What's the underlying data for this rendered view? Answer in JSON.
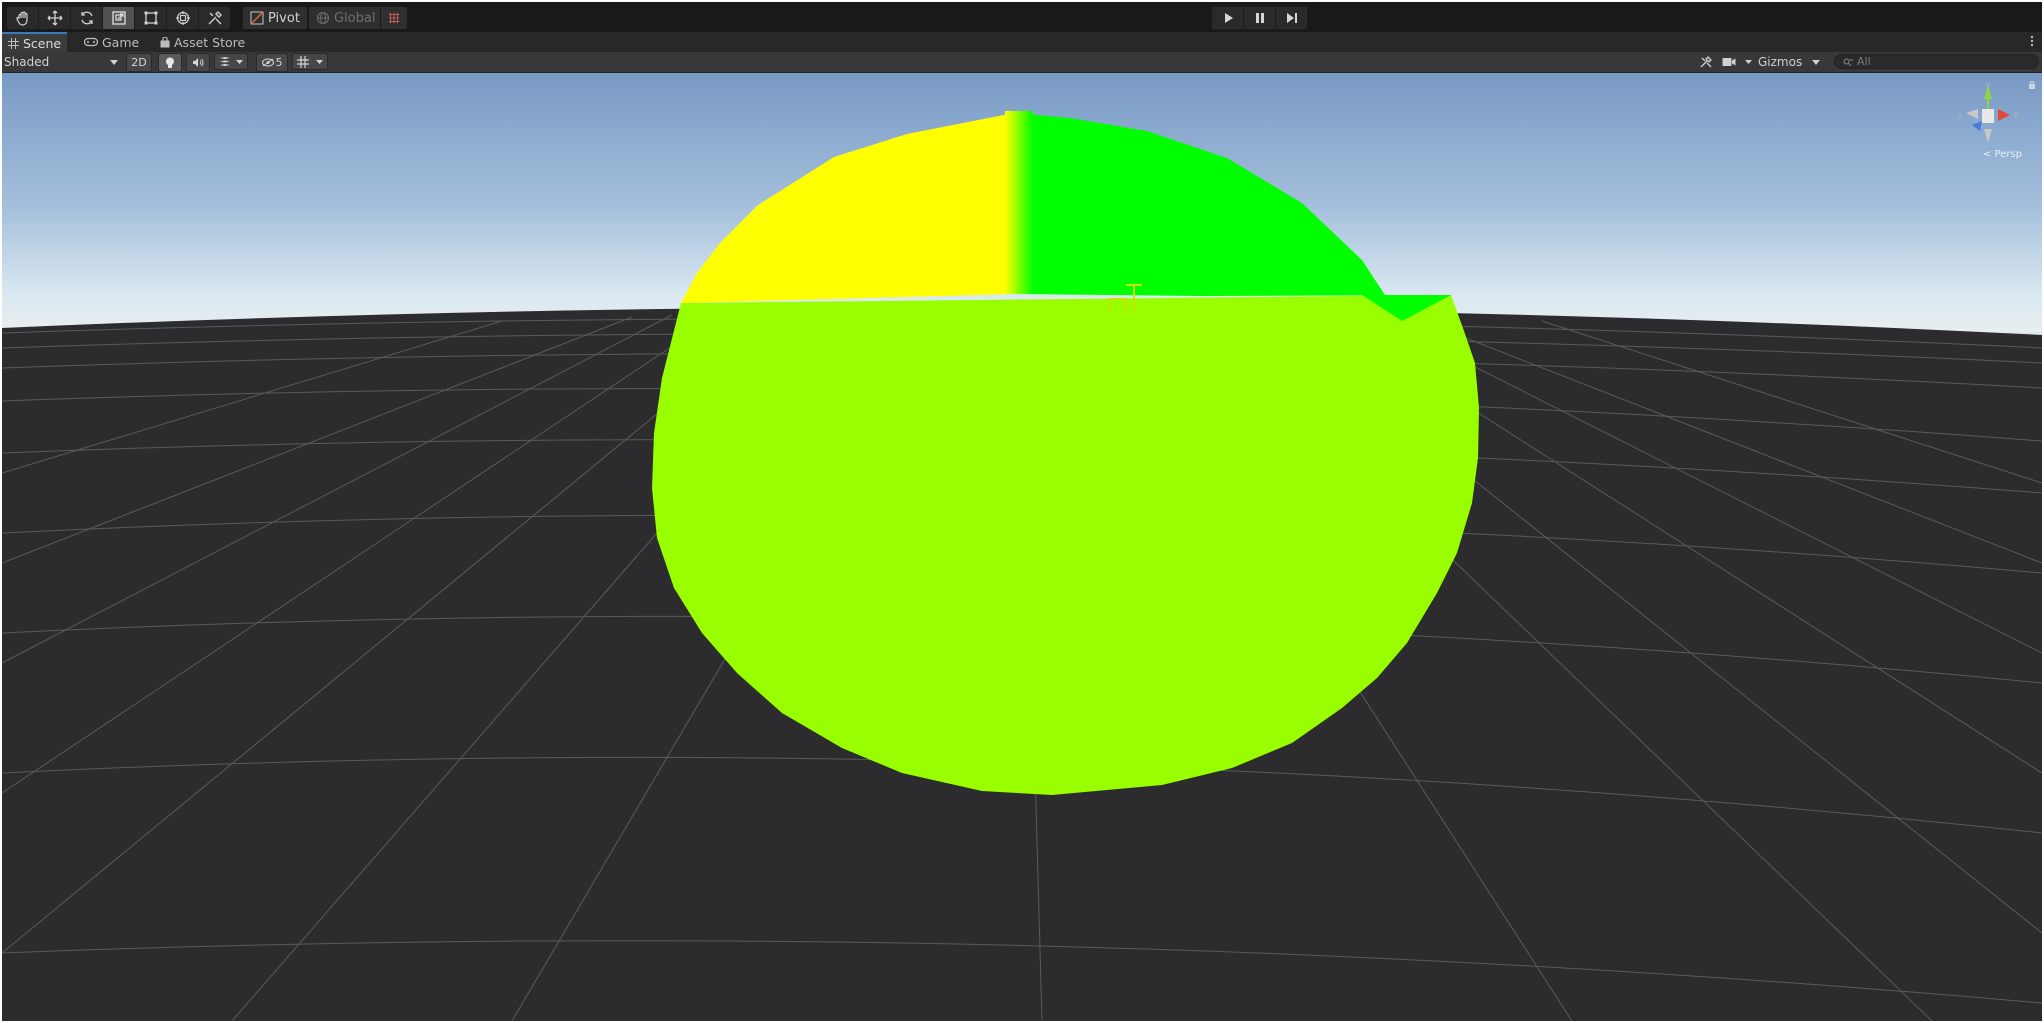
{
  "toolbar": {
    "tools": [
      {
        "name": "hand-tool",
        "icon": "hand-icon"
      },
      {
        "name": "move-tool",
        "icon": "move-arrows-icon"
      },
      {
        "name": "rotate-tool",
        "icon": "rotate-icon"
      },
      {
        "name": "scale-tool",
        "icon": "scale-icon",
        "active": true
      },
      {
        "name": "rect-tool",
        "icon": "rect-transform-icon"
      },
      {
        "name": "transform-tool",
        "icon": "transform-icon"
      },
      {
        "name": "custom-tool",
        "icon": "custom-tools-icon"
      }
    ],
    "pivot_label": "Pivot",
    "global_label": "Global",
    "snap_icon": "grid-snap-icon",
    "playback": [
      "play-icon",
      "pause-icon",
      "step-icon"
    ]
  },
  "tabs": {
    "scene": "Scene",
    "game": "Game",
    "asset_store": "Asset Store",
    "menu_icon": "vertical-dots-icon"
  },
  "scene_toolbar": {
    "draw_mode": "Shaded",
    "mode_2d": "2D",
    "hidden_count": "5",
    "gizmos_label": "Gizmos",
    "search_placeholder": "All",
    "icons": [
      "light-bulb-icon",
      "audio-icon",
      "effects-icon",
      "visibility-icon",
      "grid-icon",
      "tools-icon",
      "camera-icon"
    ]
  },
  "orientation_gizmo": {
    "axes": [
      "y",
      "x",
      "z"
    ],
    "persp_label": "< Persp"
  },
  "colors": {
    "sphere_top_left": "#ffff00",
    "sphere_top_right": "#00ff00",
    "sphere_bottom": "#99ff00",
    "grid_floor": "#2c2c2e",
    "sky_top": "#7a9cc8",
    "accent": "#3a79bb"
  }
}
